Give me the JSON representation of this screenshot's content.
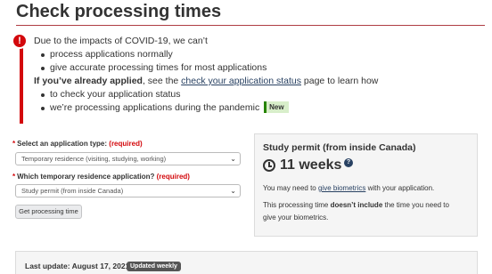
{
  "page": {
    "title": "Check processing times"
  },
  "alert": {
    "icon": "exclamation-circle-icon",
    "color": "#d3080c",
    "intro": "Due to the impacts of COVID-19, we can’t",
    "bullets_1": [
      "process applications normally",
      "give accurate processing times for most applications"
    ],
    "applied_bold": "If you’ve already applied",
    "applied_before_link": ", see the ",
    "applied_link": "check your application status",
    "applied_after_link": " page to learn how",
    "bullets_2": [
      "to check your application status",
      "we’re processing applications during the pandemic"
    ],
    "new_badge": "New"
  },
  "form": {
    "app_type": {
      "label": "Select an application type:",
      "required": "(required)",
      "value": "Temporary residence (visiting, studying, working)"
    },
    "residence_app": {
      "label": "Which temporary residence application?",
      "required": "(required)",
      "value": "Study permit (from inside Canada)"
    },
    "button_label": "Get processing time"
  },
  "result": {
    "title": "Study permit (from inside Canada)",
    "clock_icon": "clock-icon",
    "processing_time": "11 weeks",
    "help_icon": "question-circle-icon",
    "biometrics_before": "You may need to ",
    "biometrics_link": "give biometrics",
    "biometrics_after": " with your application.",
    "note_before": "This processing time ",
    "note_bold": "doesn’t include",
    "note_after": " the time you need to",
    "note_line2": "give your biometrics."
  },
  "update": {
    "label": "Last update: August 17, 2021",
    "badge": "Updated weekly"
  },
  "colors": {
    "title_rule": "#af3c43",
    "link": "#284162",
    "required": "#d3080c",
    "new_badge_bg": "#d8eeca",
    "new_badge_border": "#278400"
  }
}
